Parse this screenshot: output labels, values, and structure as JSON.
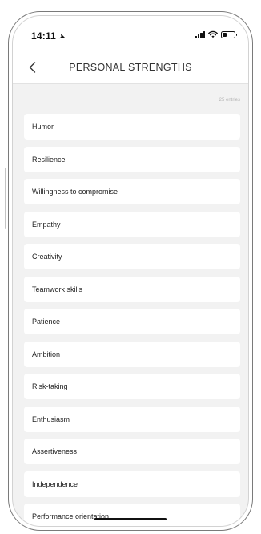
{
  "status_bar": {
    "time": "14:11",
    "icons": [
      "location-arrow-icon",
      "cellular-signal-icon",
      "wifi-icon",
      "battery-icon"
    ]
  },
  "header": {
    "back_icon": "chevron-left-icon",
    "title": "PERSONAL STRENGTHS"
  },
  "list": {
    "count_label": "25 entries",
    "items": [
      {
        "label": "Humor"
      },
      {
        "label": "Resilience"
      },
      {
        "label": "Willingness to compromise"
      },
      {
        "label": "Empathy"
      },
      {
        "label": "Creativity"
      },
      {
        "label": "Teamwork skills"
      },
      {
        "label": "Patience"
      },
      {
        "label": "Ambition"
      },
      {
        "label": "Risk-taking"
      },
      {
        "label": "Enthusiasm"
      },
      {
        "label": "Assertiveness"
      },
      {
        "label": "Independence"
      },
      {
        "label": "Performance orientation"
      }
    ]
  },
  "colors": {
    "background": "#f2f2f2",
    "card": "#ffffff",
    "text": "#222222",
    "muted": "#b3b3b3"
  }
}
